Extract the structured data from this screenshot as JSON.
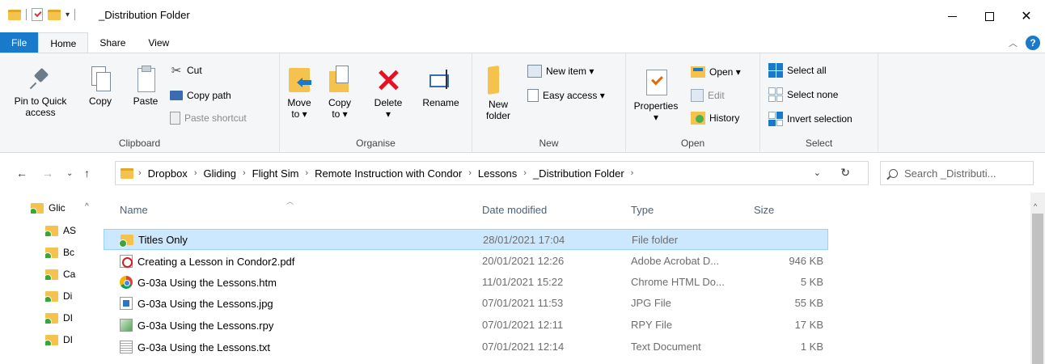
{
  "window": {
    "title": "_Distribution Folder",
    "quick_access_arrow": "▾"
  },
  "tabs": {
    "file": "File",
    "home": "Home",
    "share": "Share",
    "view": "View"
  },
  "ribbon": {
    "clipboard": {
      "label": "Clipboard",
      "pin_line1": "Pin to Quick",
      "pin_line2": "access",
      "copy": "Copy",
      "paste": "Paste",
      "cut": "Cut",
      "copy_path": "Copy path",
      "paste_shortcut": "Paste shortcut"
    },
    "organise": {
      "label": "Organise",
      "move_line1": "Move",
      "move_line2": "to ▾",
      "copy_line1": "Copy",
      "copy_line2": "to ▾",
      "delete": "Delete",
      "delete_drop": "▾",
      "rename": "Rename"
    },
    "new": {
      "label": "New",
      "new_folder_line1": "New",
      "new_folder_line2": "folder",
      "new_item": "New item ▾",
      "easy_access": "Easy access ▾"
    },
    "open": {
      "label": "Open",
      "properties": "Properties",
      "properties_drop": "▾",
      "open": "Open ▾",
      "edit": "Edit",
      "history": "History"
    },
    "select": {
      "label": "Select",
      "select_all": "Select all",
      "select_none": "Select none",
      "invert_selection": "Invert selection"
    }
  },
  "address": {
    "crumbs": [
      "Dropbox",
      "Gliding",
      "Flight Sim",
      "Remote Instruction with Condor",
      "Lessons",
      "_Distribution Folder"
    ],
    "search_placeholder": "Search _Distributi..."
  },
  "nav_pane": {
    "items": [
      "Glic",
      "AS",
      "Bc",
      "Ca",
      "Di",
      "DI",
      "DI"
    ]
  },
  "columns": {
    "name": "Name",
    "date_modified": "Date modified",
    "type": "Type",
    "size": "Size"
  },
  "files": [
    {
      "name": "Titles Only",
      "date": "28/01/2021 17:04",
      "type": "File folder",
      "size": "",
      "icon": "folder-icon",
      "selected": true
    },
    {
      "name": "Creating a Lesson in Condor2.pdf",
      "date": "20/01/2021 12:26",
      "type": "Adobe Acrobat D...",
      "size": "946 KB",
      "icon": "pdf-file-icon",
      "selected": false
    },
    {
      "name": "G-03a Using the Lessons.htm",
      "date": "11/01/2021 15:22",
      "type": "Chrome HTML Do...",
      "size": "5 KB",
      "icon": "chrome-file-icon",
      "selected": false
    },
    {
      "name": "G-03a Using the Lessons.jpg",
      "date": "07/01/2021 11:53",
      "type": "JPG File",
      "size": "55 KB",
      "icon": "image-file-icon",
      "selected": false
    },
    {
      "name": "G-03a Using the Lessons.rpy",
      "date": "07/01/2021 12:11",
      "type": "RPY File",
      "size": "17 KB",
      "icon": "rpy-file-icon",
      "selected": false
    },
    {
      "name": "G-03a Using the Lessons.txt",
      "date": "07/01/2021 12:14",
      "type": "Text Document",
      "size": "1 KB",
      "icon": "text-file-icon",
      "selected": false
    }
  ]
}
